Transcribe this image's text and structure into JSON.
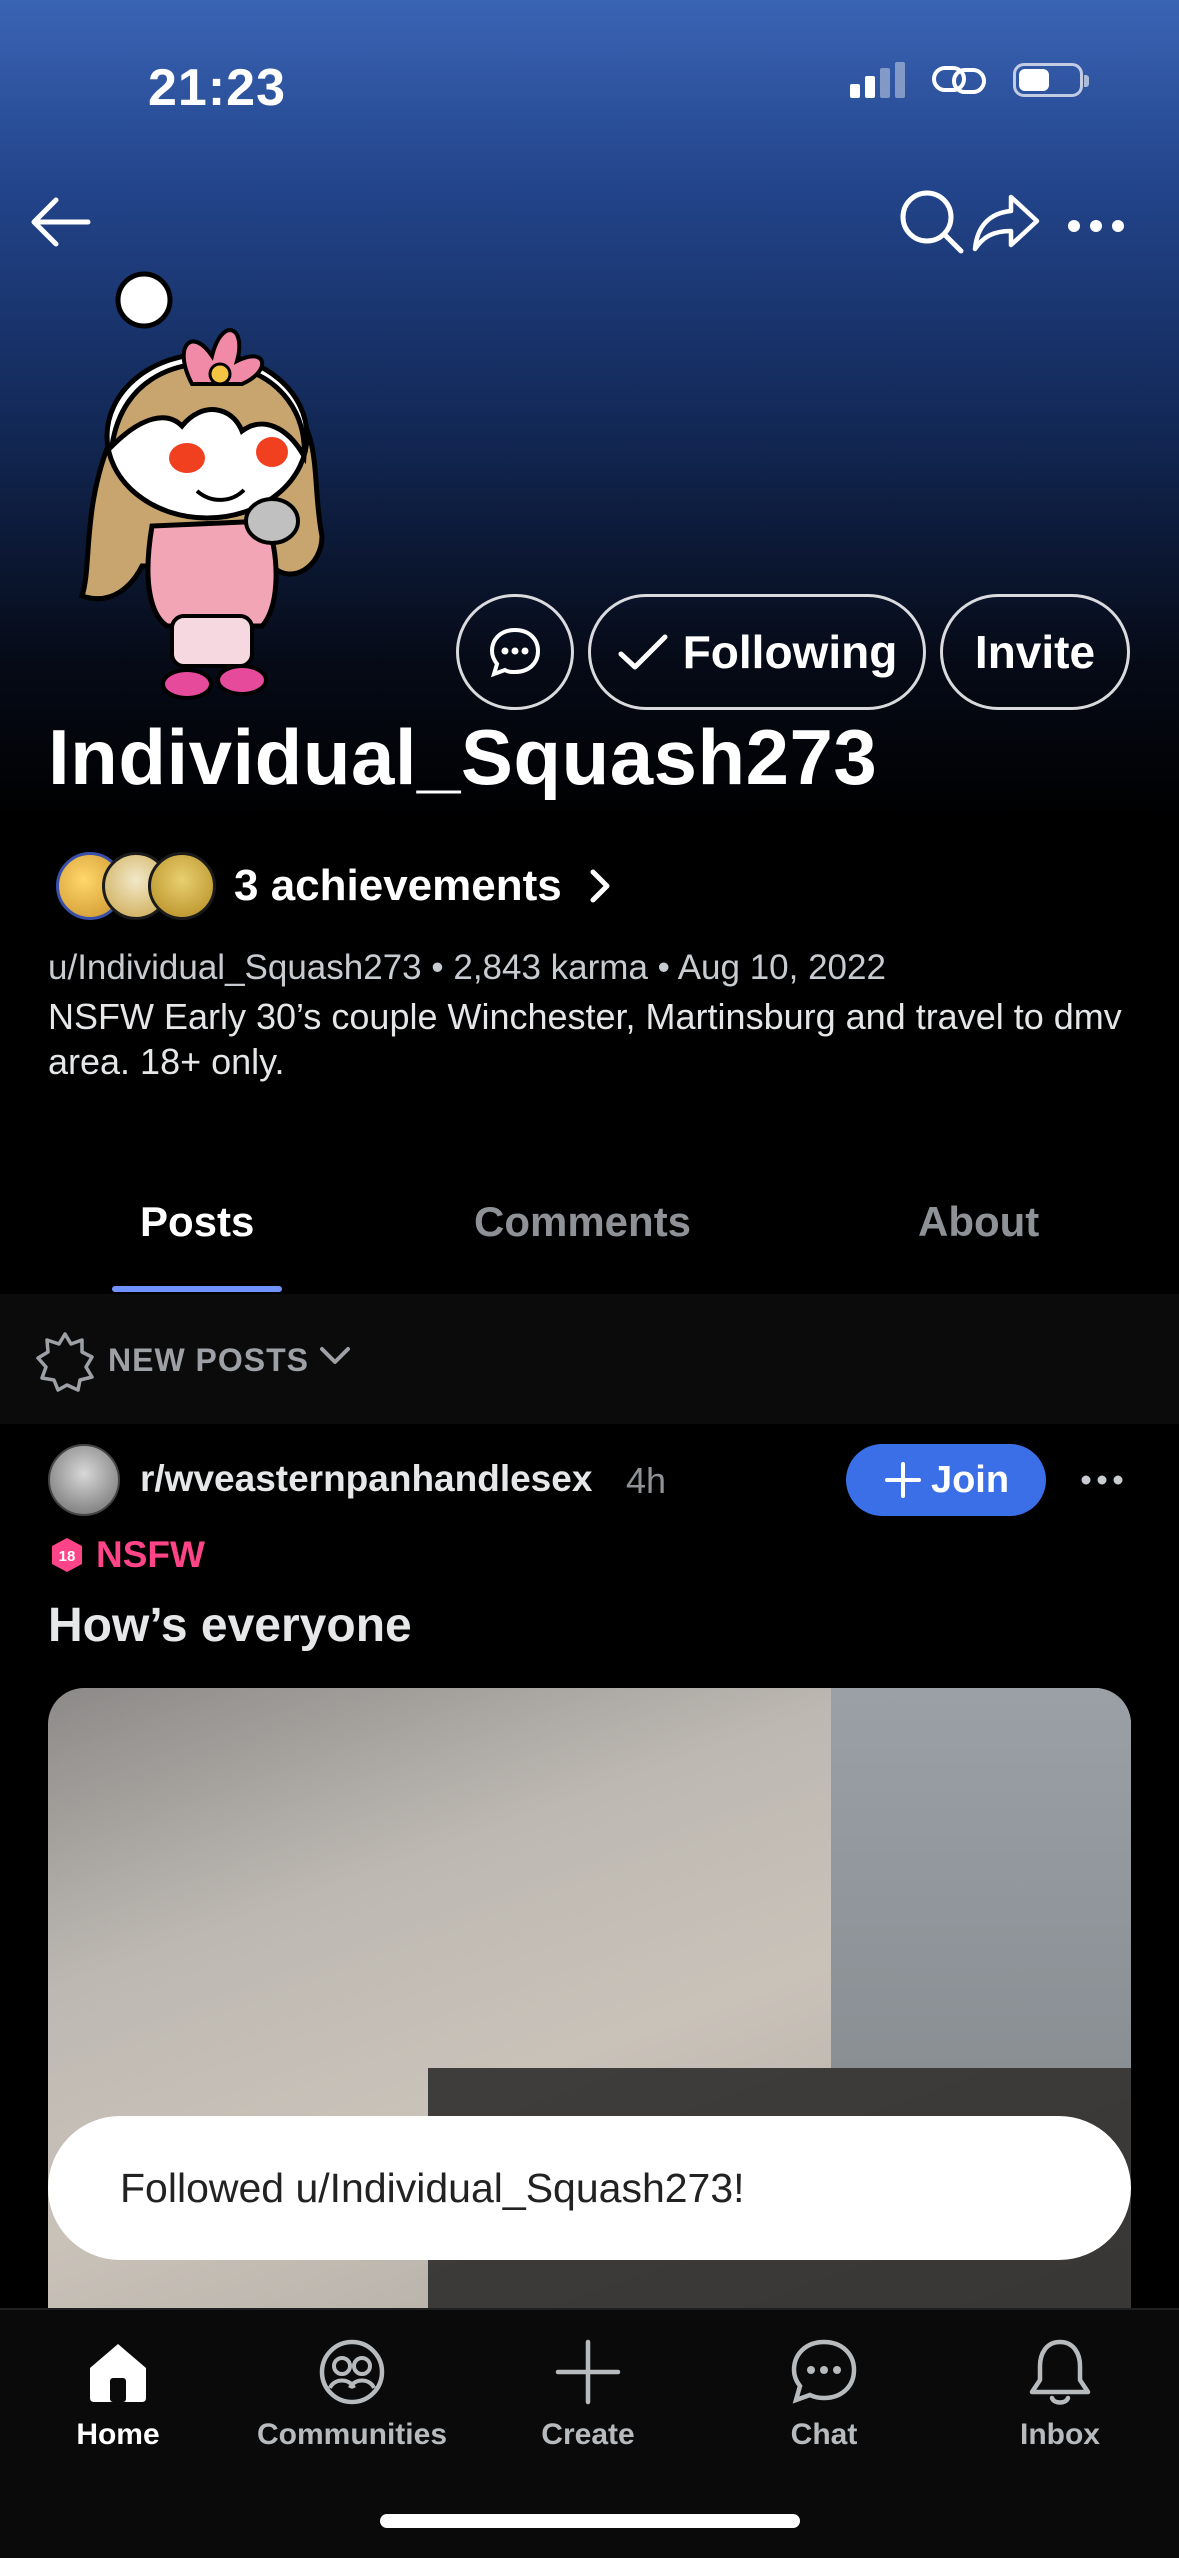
{
  "status_bar": {
    "time": "21:23"
  },
  "profile": {
    "username": "Individual_Squash273",
    "achievements_label": "3 achievements",
    "handle": "u/Individual_Squash273",
    "karma": "2,843 karma",
    "joined": "Aug 10, 2022",
    "bio": "NSFW Early 30’s couple Winchester, Martinsburg and travel to dmv area. 18+ only."
  },
  "actions": {
    "following_label": "Following",
    "invite_label": "Invite"
  },
  "tabs": [
    {
      "label": "Posts",
      "active": true
    },
    {
      "label": "Comments",
      "active": false
    },
    {
      "label": "About",
      "active": false
    }
  ],
  "sort": {
    "label": "NEW POSTS"
  },
  "post": {
    "subreddit": "r/wveasternpanhandlesex",
    "time": "4h",
    "join_label": "Join",
    "nsfw_label": "NSFW",
    "title": "How’s everyone"
  },
  "toast": {
    "message": "Followed u/Individual_Squash273!"
  },
  "bottom_nav": [
    {
      "label": "Home",
      "icon": "home-icon",
      "active": true
    },
    {
      "label": "Communities",
      "icon": "communities-icon",
      "active": false
    },
    {
      "label": "Create",
      "icon": "plus-icon",
      "active": false
    },
    {
      "label": "Chat",
      "icon": "chat-icon",
      "active": false
    },
    {
      "label": "Inbox",
      "icon": "bell-icon",
      "active": false
    }
  ],
  "colors": {
    "accent": "#3a6fe8",
    "tab_indicator": "#7193ff",
    "nsfw": "#ff4588"
  }
}
